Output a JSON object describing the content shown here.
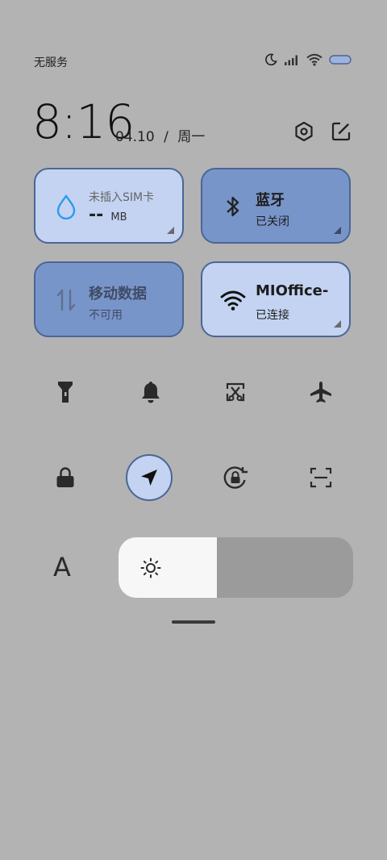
{
  "status_bar": {
    "carrier": "无服务",
    "icons": [
      "moon-icon",
      "signal-icon",
      "wifi-icon",
      "battery-icon"
    ]
  },
  "header": {
    "time": "8:16",
    "date": "04.10",
    "separator": "/",
    "weekday": "周一",
    "buttons": [
      "settings-icon",
      "edit-icon"
    ]
  },
  "tiles": {
    "data_usage": {
      "title": "未插入SIM卡",
      "value": "--",
      "unit": "MB"
    },
    "bluetooth": {
      "title": "蓝牙",
      "status": "已关闭"
    },
    "mobile_data": {
      "title": "移动数据",
      "status": "不可用"
    },
    "wifi": {
      "title": "MIOffice-",
      "status": "已连接"
    }
  },
  "toggles_row1": [
    "flashlight-icon",
    "bell-icon",
    "screenshot-scissors-icon",
    "airplane-icon"
  ],
  "toggles_row2": [
    "lock-icon",
    "location-icon",
    "rotation-lock-icon",
    "scan-icon"
  ],
  "brightness": {
    "auto_label": "A",
    "level": 0.42
  },
  "colors": {
    "background": "#b3b3b3",
    "tile_light": "#c3d3f1",
    "tile_dark": "#7895c9",
    "tile_border": "#4b6596",
    "droplet": "#2a9bf0"
  }
}
